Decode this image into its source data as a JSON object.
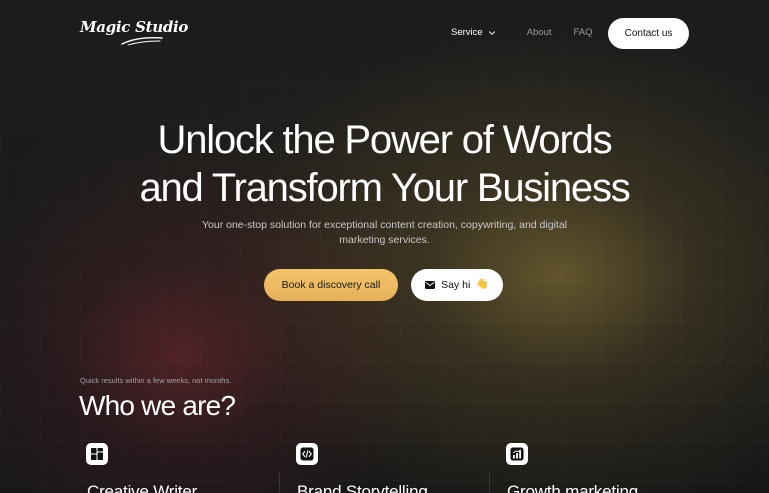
{
  "header": {
    "logo_text": "Magic Studio",
    "nav": [
      {
        "label": "Service",
        "has_dropdown": true,
        "active": true
      },
      {
        "label": "About"
      },
      {
        "label": "FAQ"
      }
    ],
    "contact_label": "Contact us"
  },
  "hero": {
    "title_line1": "Unlock the Power of Words",
    "title_line2": "and Transform Your Business",
    "subtitle": "Your one-stop solution for exceptional content creation, copywriting, and digital marketing services.",
    "primary_button": "Book a discovery call",
    "secondary_button": "Say hi",
    "secondary_emoji": "👋"
  },
  "about": {
    "eyebrow": "Quick results within a few weeks, not months.",
    "title": "Who we are?",
    "features": [
      {
        "title": "Creative Writer",
        "icon": "grid-icon"
      },
      {
        "title": "Brand Storytelling",
        "icon": "code-icon"
      },
      {
        "title": "Growth marketing",
        "icon": "bar-chart-icon"
      }
    ]
  },
  "colors": {
    "background": "#181818",
    "accent": "#f3c46a",
    "text": "#ffffff",
    "muted_text": "#c9c9c9"
  }
}
